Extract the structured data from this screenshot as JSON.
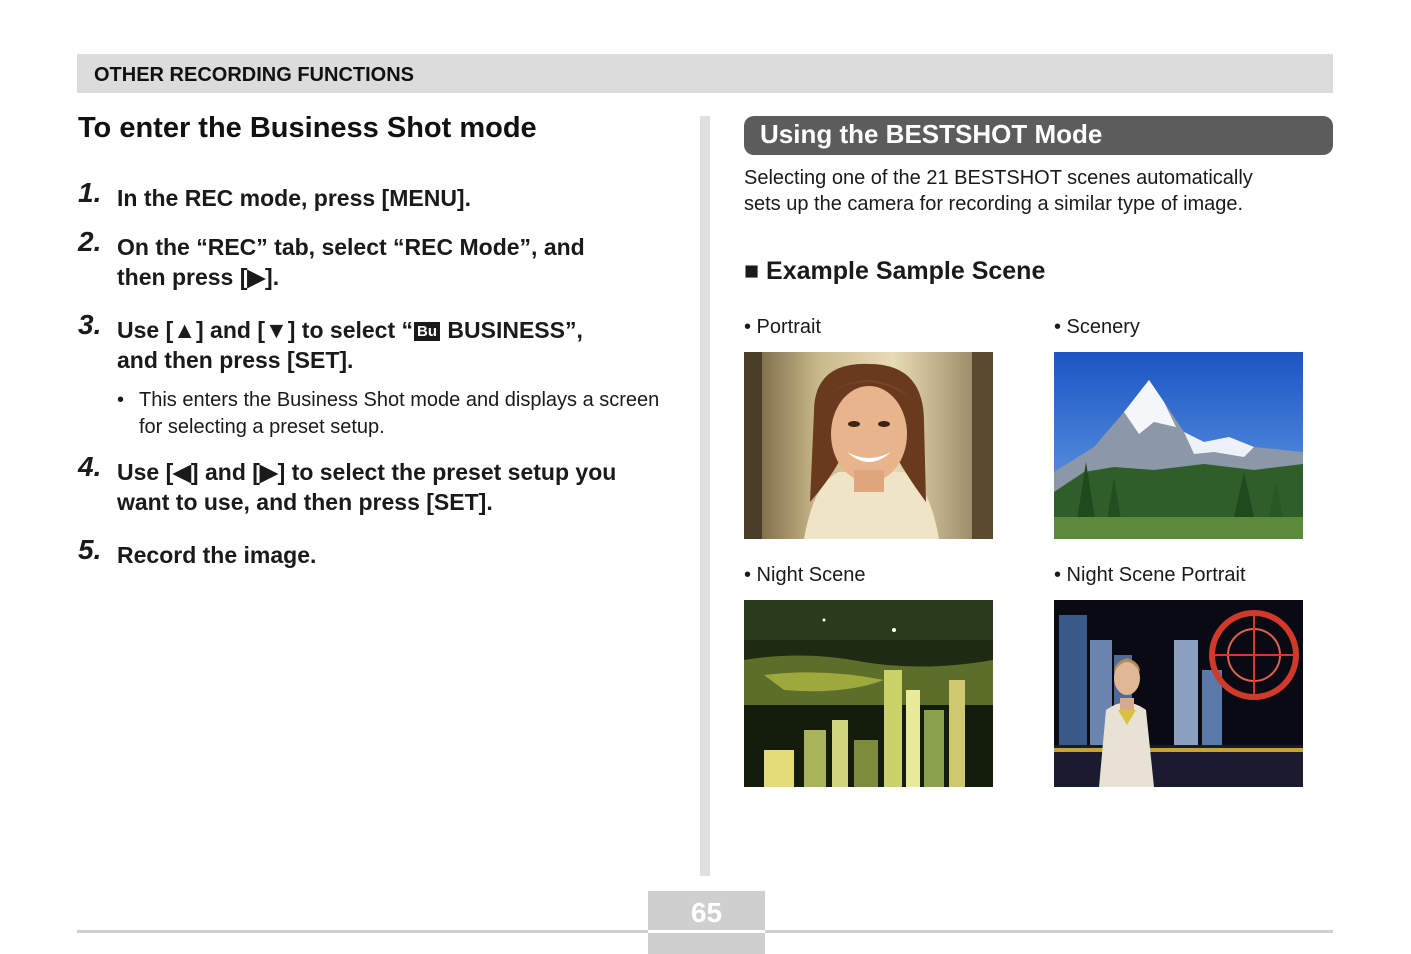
{
  "header": {
    "section": "OTHER RECORDING FUNCTIONS"
  },
  "left": {
    "title": "To enter the Business Shot mode",
    "steps": [
      {
        "num": "1.",
        "text": "In the REC mode, press [MENU]."
      },
      {
        "num": "2.",
        "line1": "On the “REC” tab, select “REC Mode”, and",
        "line2": "then press [▶]."
      },
      {
        "num": "3.",
        "pre": "Use [▲] and [▼] to select “",
        "icon": "Bu",
        "post": " BUSINESS”,",
        "line2": "and then press [SET].",
        "note": "This enters the Business Shot mode and displays a screen for selecting a preset setup."
      },
      {
        "num": "4.",
        "line1": "Use [◀] and [▶] to select the preset setup you",
        "line2": "want to use, and then press [SET]."
      },
      {
        "num": "5.",
        "text": "Record the image."
      }
    ]
  },
  "right": {
    "header": "Using the BESTSHOT Mode",
    "intro_line1": "Selecting one of the 21 BESTSHOT scenes automatically",
    "intro_line2": "sets up the camera for recording a similar type of image.",
    "sample_heading": "■ Example Sample Scene",
    "scenes": [
      {
        "label": "• Portrait"
      },
      {
        "label": "• Scenery"
      },
      {
        "label": "• Night Scene"
      },
      {
        "label": "• Night Scene Portrait"
      }
    ]
  },
  "footer": {
    "page_number": "65"
  }
}
